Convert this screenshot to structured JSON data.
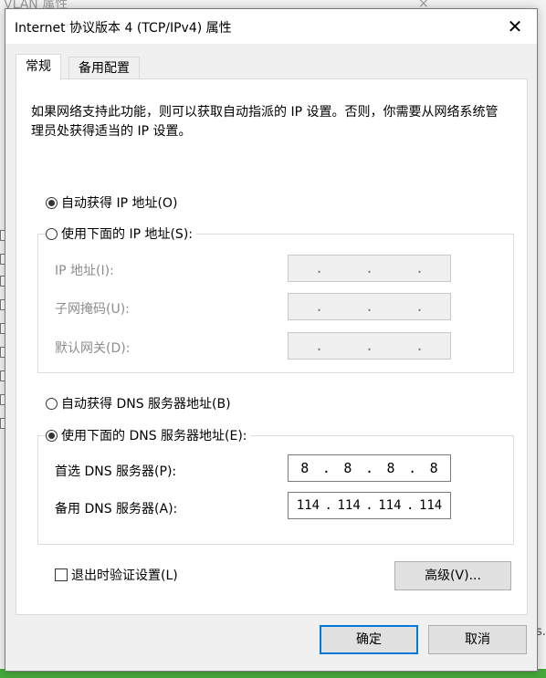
{
  "background": {
    "title_fragment": "VLAN 属性",
    "close_fragment": "×",
    "right_fragment": "s."
  },
  "dialog": {
    "title": "Internet 协议版本 4 (TCP/IPv4) 属性",
    "close_glyph": "✕"
  },
  "tabs": [
    {
      "label": "常规",
      "active": true
    },
    {
      "label": "备用配置",
      "active": false
    }
  ],
  "general": {
    "description": "如果网络支持此功能，则可以获取自动指派的 IP 设置。否则，你需要从网络系统管理员处获得适当的 IP 设置。",
    "auto_ip_label": "自动获得 IP 地址(O)",
    "manual_ip_label": "使用下面的 IP 地址(S):",
    "ip_address_label": "IP 地址(I):",
    "subnet_mask_label": "子网掩码(U):",
    "gateway_label": "默认网关(D):",
    "auto_dns_label": "自动获得 DNS 服务器地址(B)",
    "manual_dns_label": "使用下面的 DNS 服务器地址(E):",
    "preferred_dns_label": "首选 DNS 服务器(P):",
    "alternate_dns_label": "备用 DNS 服务器(A):",
    "preferred_dns": [
      "8",
      "8",
      "8",
      "8"
    ],
    "alternate_dns": [
      "114",
      "114",
      "114",
      "114"
    ],
    "ip_separator": ".",
    "validate_label": "退出时验证设置(L)",
    "advanced_button": "高级(V)..."
  },
  "state": {
    "ip_mode": "auto",
    "dns_mode": "manual",
    "validate_checked": false
  },
  "footer": {
    "ok_button": "确定",
    "cancel_button": "取消"
  },
  "colors": {
    "accent": "#0078d7",
    "taskbar_green": "#46a83a"
  }
}
